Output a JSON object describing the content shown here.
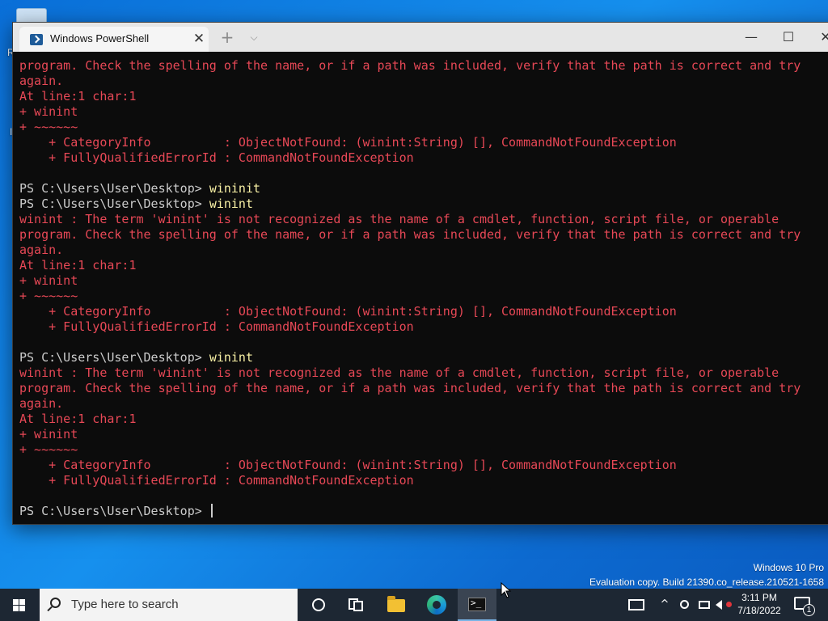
{
  "desktop": {
    "left_fragments": [
      "R",
      "I"
    ],
    "watermark_line1": "Windows 10 Pro",
    "watermark_line2": "Evaluation copy. Build 21390.co_release.210521-1658"
  },
  "window": {
    "tab_title": "Windows PowerShell",
    "tab_close": "✕",
    "new_tab": "+",
    "tab_dropdown": "⌵",
    "minimize": "—",
    "maximize": "☐",
    "close": "✕"
  },
  "console": {
    "lines": [
      {
        "type": "err",
        "text": "program. Check the spelling of the name, or if a path was included, verify that the path is correct and try"
      },
      {
        "type": "err",
        "text": "again."
      },
      {
        "type": "err",
        "text": "At line:1 char:1"
      },
      {
        "type": "err",
        "text": "+ winint"
      },
      {
        "type": "err",
        "text": "+ ~~~~~~"
      },
      {
        "type": "err",
        "text": "    + CategoryInfo          : ObjectNotFound: (winint:String) [], CommandNotFoundException"
      },
      {
        "type": "err",
        "text": "    + FullyQualifiedErrorId : CommandNotFoundException"
      },
      {
        "type": "blank",
        "text": ""
      },
      {
        "type": "prompt",
        "text": "PS C:\\Users\\User\\Desktop> ",
        "cmd": "wininit"
      },
      {
        "type": "prompt",
        "text": "PS C:\\Users\\User\\Desktop> ",
        "cmd": "winint"
      },
      {
        "type": "err",
        "text": "winint : The term 'winint' is not recognized as the name of a cmdlet, function, script file, or operable"
      },
      {
        "type": "err",
        "text": "program. Check the spelling of the name, or if a path was included, verify that the path is correct and try"
      },
      {
        "type": "err",
        "text": "again."
      },
      {
        "type": "err",
        "text": "At line:1 char:1"
      },
      {
        "type": "err",
        "text": "+ winint"
      },
      {
        "type": "err",
        "text": "+ ~~~~~~"
      },
      {
        "type": "err",
        "text": "    + CategoryInfo          : ObjectNotFound: (winint:String) [], CommandNotFoundException"
      },
      {
        "type": "err",
        "text": "    + FullyQualifiedErrorId : CommandNotFoundException"
      },
      {
        "type": "blank",
        "text": ""
      },
      {
        "type": "prompt",
        "text": "PS C:\\Users\\User\\Desktop> ",
        "cmd": "winint"
      },
      {
        "type": "err",
        "text": "winint : The term 'winint' is not recognized as the name of a cmdlet, function, script file, or operable"
      },
      {
        "type": "err",
        "text": "program. Check the spelling of the name, or if a path was included, verify that the path is correct and try"
      },
      {
        "type": "err",
        "text": "again."
      },
      {
        "type": "err",
        "text": "At line:1 char:1"
      },
      {
        "type": "err",
        "text": "+ winint"
      },
      {
        "type": "err",
        "text": "+ ~~~~~~"
      },
      {
        "type": "err",
        "text": "    + CategoryInfo          : ObjectNotFound: (winint:String) [], CommandNotFoundException"
      },
      {
        "type": "err",
        "text": "    + FullyQualifiedErrorId : CommandNotFoundException"
      },
      {
        "type": "blank",
        "text": ""
      },
      {
        "type": "prompt",
        "text": "PS C:\\Users\\User\\Desktop> ",
        "cmd": "",
        "cursor": true
      }
    ]
  },
  "taskbar": {
    "search_placeholder": "Type here to search",
    "apps": [
      "cortana-icon",
      "task-view-icon",
      "file-explorer-icon",
      "edge-icon",
      "windows-terminal-icon"
    ],
    "tray": {
      "up_arrow": "^",
      "time": "3:11 PM",
      "date": "7/18/2022",
      "notification_count": "1"
    }
  },
  "colors": {
    "error_text": "#e74856",
    "prompt_text": "#cccccc",
    "command_text": "#f9f1a5",
    "console_bg": "#0c0c0c",
    "taskbar_bg": "#1d2733"
  }
}
